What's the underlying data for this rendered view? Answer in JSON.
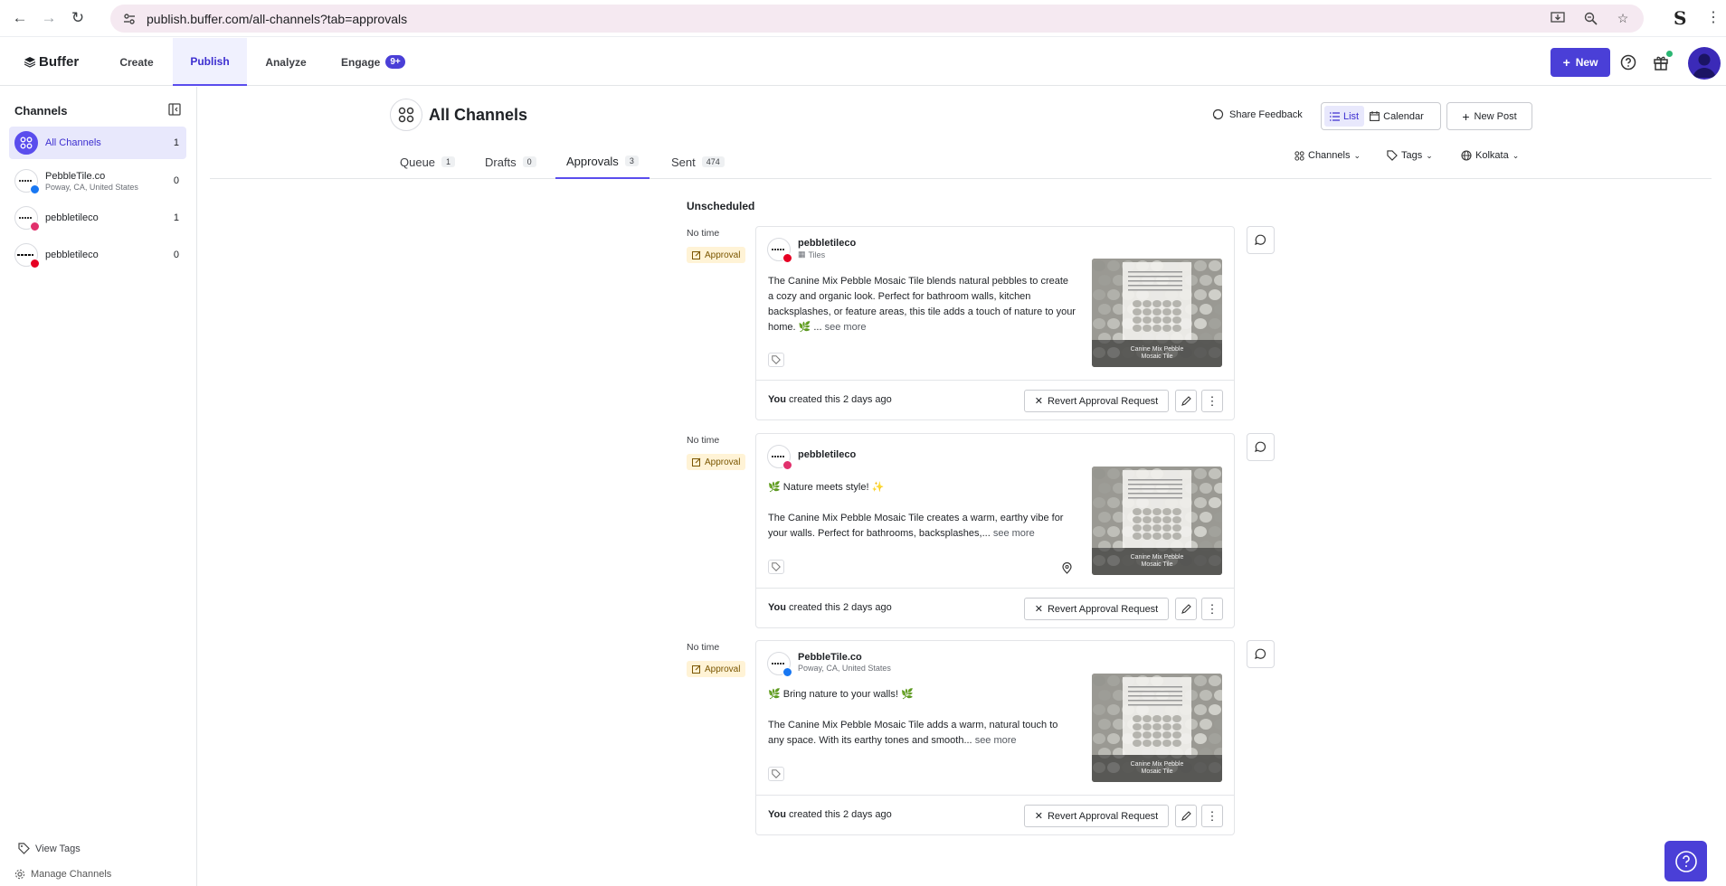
{
  "browser": {
    "url": "publish.buffer.com/all-channels?tab=approvals",
    "profile_initial": "S"
  },
  "header": {
    "logo": "Buffer",
    "tabs": [
      {
        "label": "Create"
      },
      {
        "label": "Publish"
      },
      {
        "label": "Analyze"
      },
      {
        "label": "Engage",
        "badge": "9+"
      }
    ],
    "new_button": "New",
    "accent_color": "#4a3fd7"
  },
  "sidebar": {
    "title": "Channels",
    "items": [
      {
        "name": "All Channels",
        "count": "1"
      },
      {
        "name": "PebbleTile.co",
        "sub": "Poway, CA, United States",
        "count": "0",
        "network": "facebook"
      },
      {
        "name": "pebbletileco",
        "count": "1",
        "network": "instagram"
      },
      {
        "name": "pebbletileco",
        "count": "0",
        "network": "pinterest"
      }
    ],
    "view_tags": "View Tags",
    "manage_channels": "Manage Channels"
  },
  "main": {
    "title": "All Channels",
    "share_feedback": "Share Feedback",
    "view_list": "List",
    "view_calendar": "Calendar",
    "new_post": "New Post",
    "tabs": [
      {
        "label": "Queue",
        "count": "1"
      },
      {
        "label": "Drafts",
        "count": "0"
      },
      {
        "label": "Approvals",
        "count": "3"
      },
      {
        "label": "Sent",
        "count": "474"
      }
    ],
    "filters": {
      "channels": "Channels",
      "tags": "Tags",
      "timezone": "Kolkata"
    },
    "section": "Unscheduled"
  },
  "posts": [
    {
      "time": "No time",
      "status": "Approval",
      "channel": "pebbletileco",
      "channel_sub": "Tiles",
      "network": "pinterest",
      "text": "The Canine Mix Pebble Mosaic Tile blends natural pebbles to create a cozy and organic look. Perfect for bathroom walls, kitchen backsplashes, or feature areas, this tile adds a touch of nature to your home. 🌿 ...",
      "see_more": "see more",
      "thumb_caption": "Canine Mix Pebble Mosaic Tile",
      "created": "created this 2 days ago",
      "created_by": "You",
      "revert": "Revert Approval Request"
    },
    {
      "time": "No time",
      "status": "Approval",
      "channel": "pebbletileco",
      "network": "instagram",
      "headline": "🌿 Nature meets style! ✨",
      "text": "The Canine Mix Pebble Mosaic Tile creates a warm, earthy vibe for your walls. Perfect for bathrooms, backsplashes,...",
      "see_more": "see more",
      "thumb_caption": "Canine Mix Pebble Mosaic Tile",
      "created": "created this 2 days ago",
      "created_by": "You",
      "revert": "Revert Approval Request"
    },
    {
      "time": "No time",
      "status": "Approval",
      "channel": "PebbleTile.co",
      "channel_sub": "Poway, CA, United States",
      "network": "facebook",
      "headline": "🌿 Bring nature to your walls! 🌿",
      "text": "The Canine Mix Pebble Mosaic Tile adds a warm, natural touch to any space. With its earthy tones and smooth...",
      "see_more": "see more",
      "thumb_caption": "Canine Mix Pebble Mosaic Tile",
      "created": "created this 2 days ago",
      "created_by": "You",
      "revert": "Revert Approval Request"
    }
  ]
}
